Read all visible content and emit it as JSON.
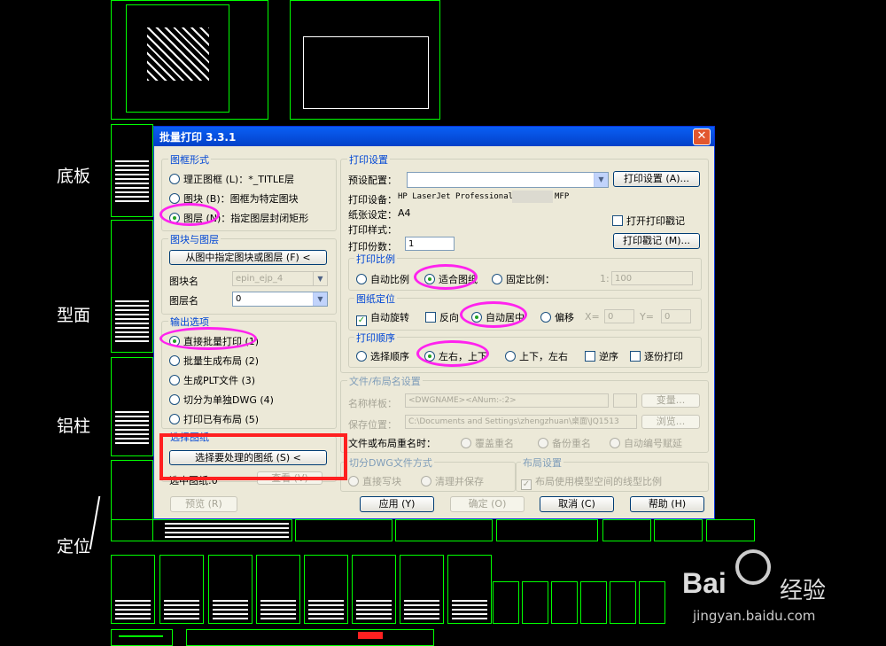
{
  "cad": {
    "labels": [
      "底板",
      "型面",
      "铝柱",
      "定位"
    ]
  },
  "watermark": {
    "brand": "Bai",
    "brand2": "经验",
    "url": "jingyan.baidu.com"
  },
  "dialog": {
    "title": "批量打印 3.3.1",
    "close": "✕",
    "frame_group": {
      "title": "图框形式",
      "options": [
        "理正图框 (L)：*_TITLE层",
        "图块 (B)：图框为特定图块",
        "图层 (N)：指定图层封闭矩形"
      ]
    },
    "block_group": {
      "title": "图块与图层",
      "pick_button": "从图中指定图块或图层 (F) <",
      "block_label": "图块名",
      "block_value": "epin_ejp_4",
      "layer_label": "图层名",
      "layer_value": "0"
    },
    "output_group": {
      "title": "输出选项",
      "options": [
        "直接批量打印 (1)",
        "批量生成布局 (2)",
        "生成PLT文件 (3)",
        "切分为单独DWG (4)",
        "打印已有布局 (5)"
      ]
    },
    "select_group": {
      "title": "选择图纸",
      "select_button": "选择要处理的图纸 (S) <",
      "selected_label": "选中图纸:0",
      "view_button": "查看 (V)"
    },
    "print_settings": {
      "title": "打印设置",
      "preset_label": "预设配置：",
      "preset_value": "",
      "settings_button": "打印设置 (A)...",
      "device_label": "打印设备：",
      "device_value": "HP LaserJet Professional",
      "device_suffix": "MFP",
      "paper_label": "纸张设定：",
      "paper_value": "A4",
      "style_label": "打印样式：",
      "copies_label": "打印份数：",
      "copies_value": "1",
      "log_check": "打开打印戳记",
      "log_button": "打印戳记 (M)..."
    },
    "scale": {
      "title": "打印比例",
      "options": [
        "自动比例",
        "适合图纸",
        "固定比例："
      ],
      "ratio_prefix": "1:",
      "ratio_value": "100"
    },
    "position": {
      "title": "图纸定位",
      "auto_rotate": "自动旋转",
      "reverse": "反向",
      "center": "自动居中",
      "offset": "偏移",
      "x_label": "X=",
      "x_value": "0",
      "y_label": "Y=",
      "y_value": "0"
    },
    "order": {
      "title": "打印顺序",
      "options": [
        "选择顺序",
        "左右，上下",
        "上下，左右"
      ],
      "reverse": "逆序",
      "split": "逐份打印"
    },
    "file_group": {
      "title": "文件/布局名设置",
      "name_label": "名称样板：",
      "name_value": "<DWGNAME><ANum:-:2>",
      "var_button": "变量...",
      "save_label": "保存位置：",
      "save_value": "C:\\Documents and Settings\\zhengzhuan\\桌面\\JQ1513",
      "browse_button": "浏览...",
      "dup_label": "文件或布局重名时：",
      "dup_options": [
        "覆盖重名",
        "备份重名",
        "自动编号赋延"
      ]
    },
    "dwg_group": {
      "title": "切分DWG文件方式",
      "options": [
        "直接写块",
        "清理并保存"
      ]
    },
    "layout_group": {
      "title": "布局设置",
      "check": "布局使用模型空间的线型比例"
    },
    "footer": {
      "preview": "预览 (R)",
      "apply": "应用 (Y)",
      "ok": "确定 (O)",
      "cancel": "取消 (C)",
      "help": "帮助 (H)"
    }
  },
  "colors": {
    "cad_line": "#00ff00",
    "highlight": "#ff22ee",
    "redbox": "#ff2020"
  }
}
